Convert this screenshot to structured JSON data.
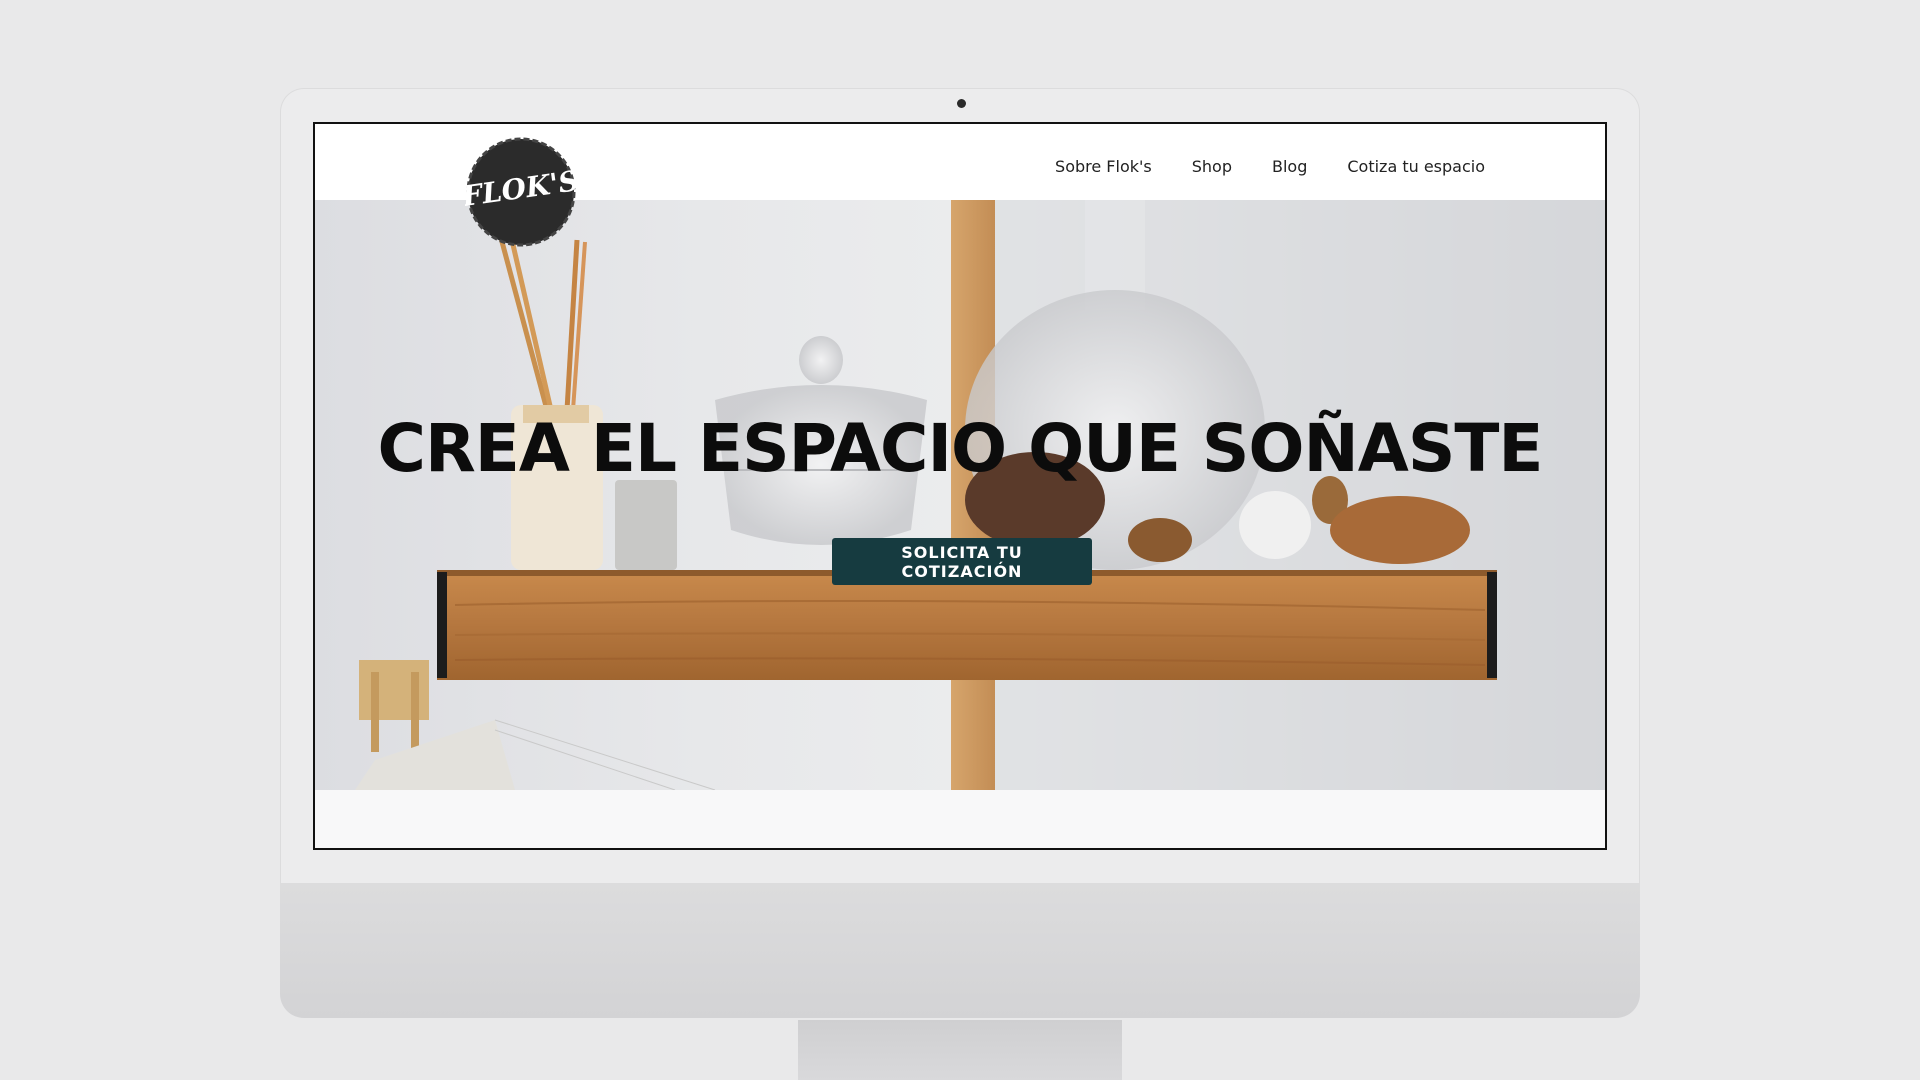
{
  "site": {
    "logo_text": "FLOK'S",
    "nav": [
      {
        "label": "Sobre Flok's"
      },
      {
        "label": "Shop"
      },
      {
        "label": "Blog"
      },
      {
        "label": "Cotiza tu espacio"
      }
    ]
  },
  "hero": {
    "title": "CREA EL ESPACIO QUE SOÑASTE",
    "cta_label": "SOLICITA TU COTIZACIÓN"
  },
  "colors": {
    "cta_background": "#163b40",
    "page_background": "#e9e9ea",
    "shelf_wood": "#b5773f"
  }
}
